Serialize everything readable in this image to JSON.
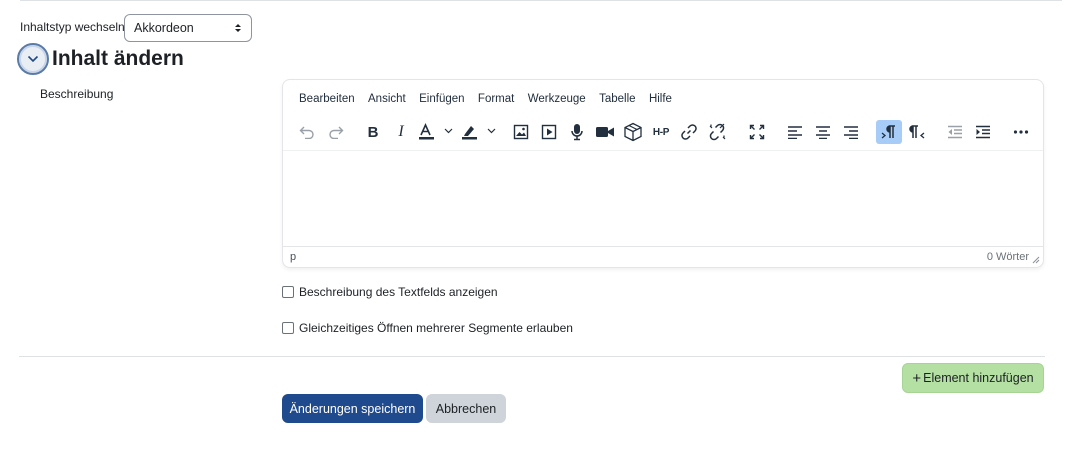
{
  "content_type": {
    "label": "Inhaltstyp wechseln",
    "selected": "Akkordeon"
  },
  "section": {
    "title": "Inhalt ändern"
  },
  "description": {
    "label": "Beschreibung"
  },
  "editor": {
    "menu": [
      "Bearbeiten",
      "Ansicht",
      "Einfügen",
      "Format",
      "Werkzeuge",
      "Tabelle",
      "Hilfe"
    ],
    "status_path": "p",
    "word_count": "0 Wörter",
    "toolbar_icons": [
      "undo-icon",
      "redo-icon",
      "bold-icon",
      "italic-icon",
      "text-color-icon",
      "highlight-color-icon",
      "image-icon",
      "media-icon",
      "record-audio-icon",
      "record-video-icon",
      "3d-box-icon",
      "h5p-icon",
      "link-icon",
      "unlink-icon",
      "fullscreen-icon",
      "align-left-icon",
      "align-center-icon",
      "align-right-icon",
      "ltr-icon",
      "rtl-icon",
      "outdent-icon",
      "indent-icon",
      "more-icon"
    ],
    "bold_glyph": "B",
    "italic_glyph": "I",
    "h5p_text": "H-P"
  },
  "options": {
    "show_description": "Beschreibung des Textfelds anzeigen",
    "allow_multiple": "Gleichzeitiges Öffnen mehrerer Segmente erlauben"
  },
  "actions": {
    "add_element": "Element hinzufügen",
    "add_plus": "+",
    "save": "Änderungen speichern",
    "cancel": "Abbrechen"
  },
  "colors": {
    "primary": "#1f4a8d",
    "add_button": "#b5e0a3",
    "active_toolbar": "#a6ccf7"
  }
}
